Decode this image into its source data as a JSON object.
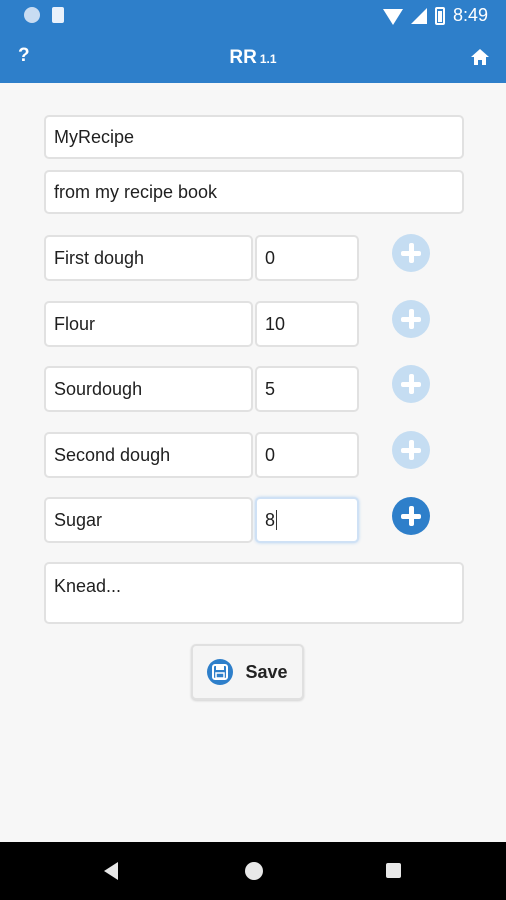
{
  "status_bar": {
    "time": "8:49"
  },
  "app_bar": {
    "help_label": "?",
    "title": "RR",
    "version": "1.1"
  },
  "recipe": {
    "name": "MyRecipe",
    "source": "from my recipe book",
    "ingredients": [
      {
        "name": "First dough",
        "amount": "0"
      },
      {
        "name": "Flour",
        "amount": "10"
      },
      {
        "name": "Sourdough",
        "amount": "5"
      },
      {
        "name": "Second dough",
        "amount": "0"
      },
      {
        "name": "Sugar",
        "amount": "8"
      }
    ],
    "instructions": "Knead..."
  },
  "actions": {
    "save_label": "Save"
  },
  "colors": {
    "primary": "#2e7fca",
    "add_disabled": "#c5ddf2"
  }
}
